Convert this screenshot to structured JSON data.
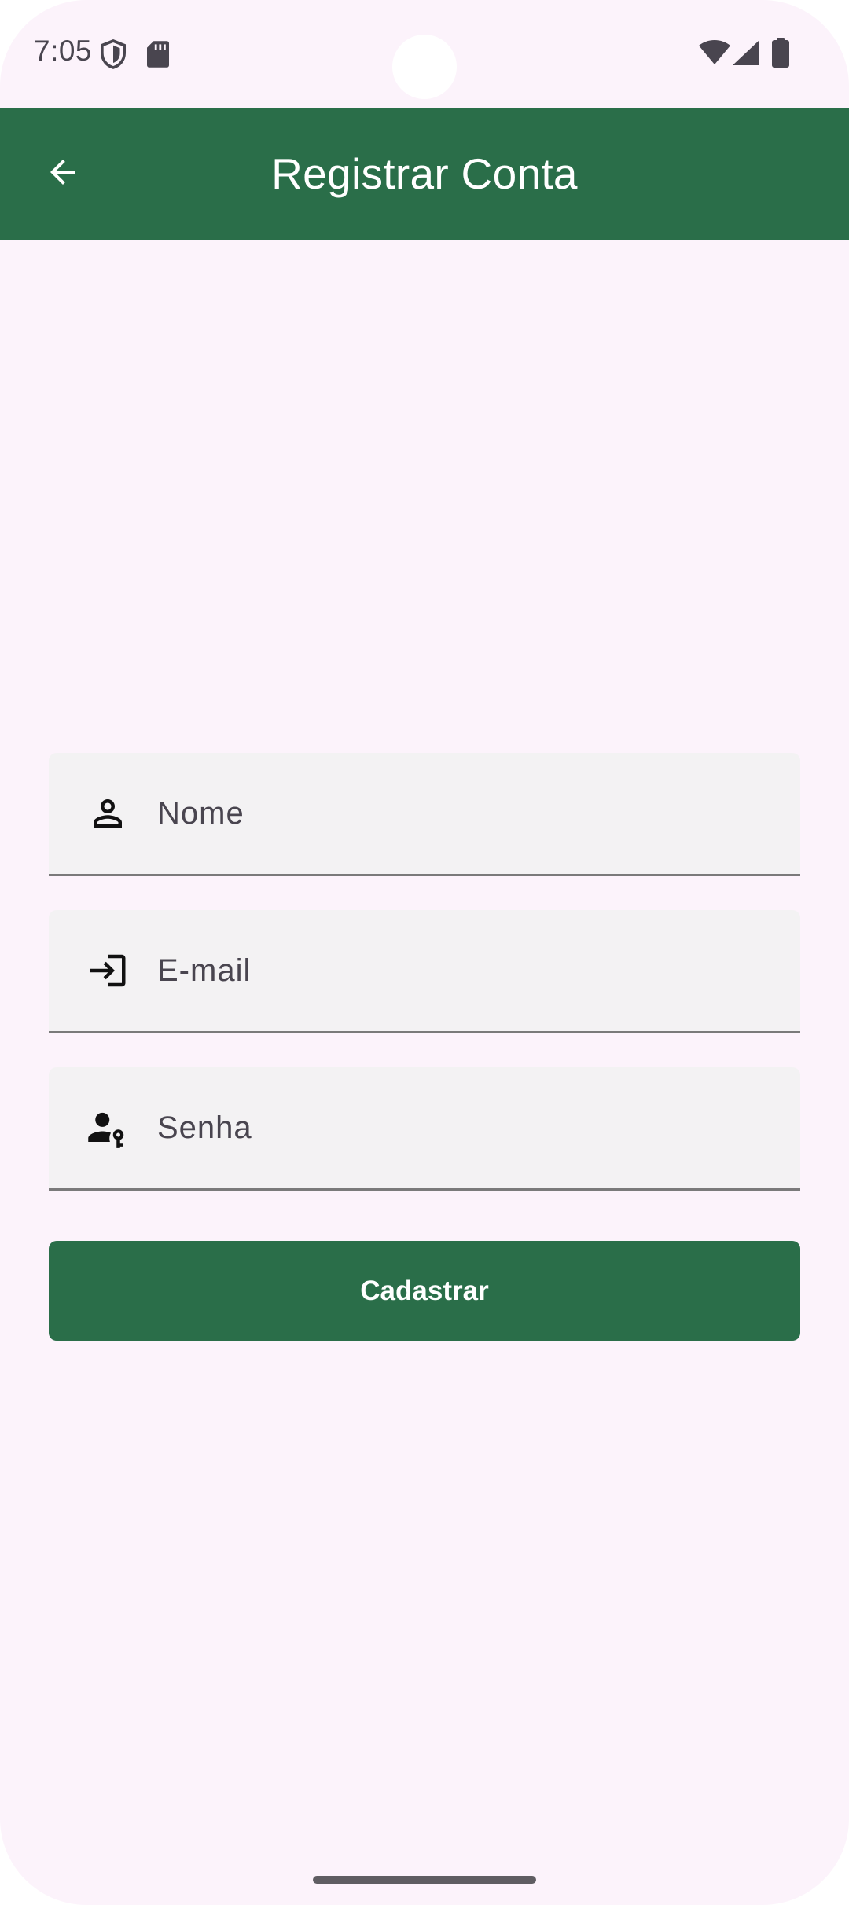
{
  "status_bar": {
    "time": "7:05",
    "icons": [
      "shield-icon",
      "sd-card-icon",
      "wifi-icon",
      "cell-signal-icon",
      "battery-icon"
    ]
  },
  "app_bar": {
    "title": "Registrar Conta",
    "back_icon": "arrow-back-icon",
    "background": "#2a6e49"
  },
  "form": {
    "name_field": {
      "placeholder": "Nome",
      "value": "",
      "icon": "person-icon"
    },
    "email_field": {
      "placeholder": "E-mail",
      "value": "",
      "icon": "login-icon"
    },
    "password_field": {
      "placeholder": "Senha",
      "value": "",
      "icon": "person-key-icon"
    },
    "submit_label": "Cadastrar"
  },
  "colors": {
    "primary": "#2a6e49",
    "background": "#fcf3fb",
    "field_background": "#f3f2f3"
  }
}
